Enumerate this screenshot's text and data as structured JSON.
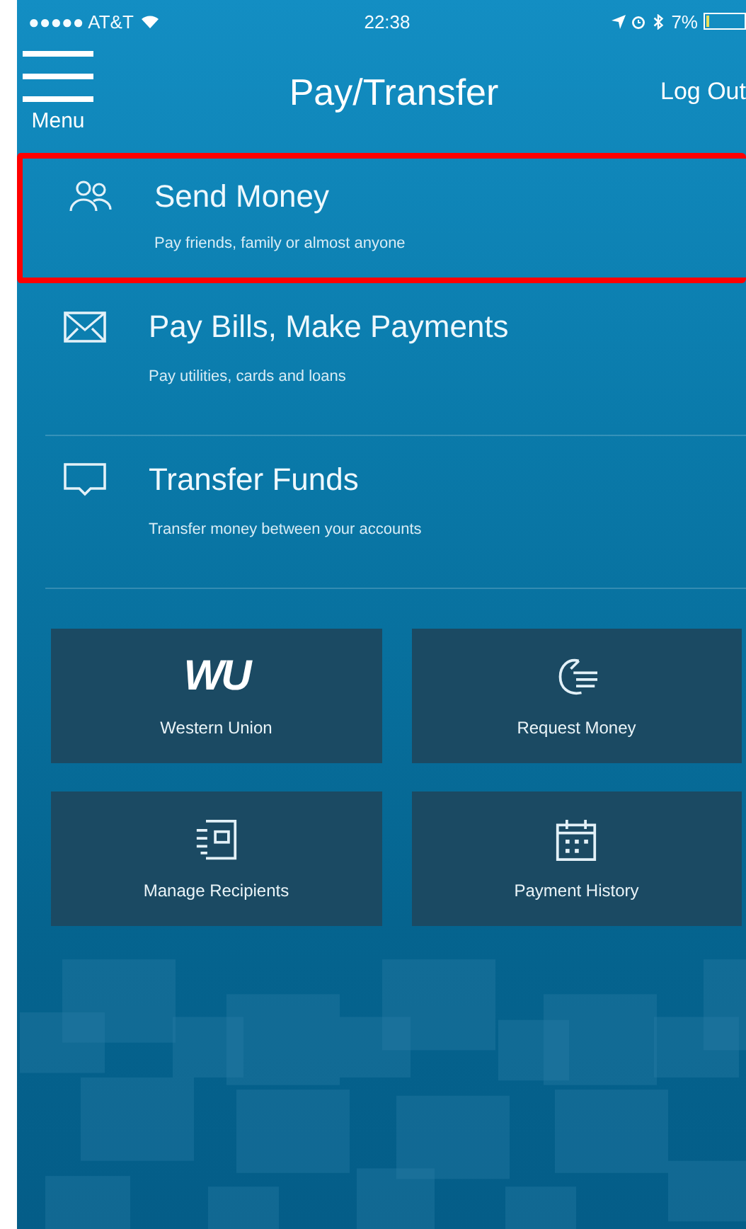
{
  "status_bar": {
    "carrier": "●●●●● AT&T",
    "time": "22:38",
    "battery": "7%"
  },
  "header": {
    "menu_label": "Menu",
    "title": "Pay/Transfer",
    "action": "Log Out"
  },
  "options": [
    {
      "kind": "people",
      "title": "Send Money",
      "subtitle": "Pay friends, family or almost anyone",
      "highlighted": true
    },
    {
      "kind": "envelope",
      "title": "Pay Bills, Make Payments",
      "subtitle": "Pay utilities, cards and loans",
      "highlighted": false
    },
    {
      "kind": "screen",
      "title": "Transfer Funds",
      "subtitle": "Transfer money between your accounts",
      "highlighted": false
    }
  ],
  "tiles": [
    {
      "kind": "logo",
      "logo": "WU",
      "label": "Western Union"
    },
    {
      "kind": "hand",
      "label": "Request Money"
    },
    {
      "kind": "recipients",
      "label": "Manage Recipients"
    },
    {
      "kind": "calendar",
      "label": "Payment History"
    }
  ]
}
